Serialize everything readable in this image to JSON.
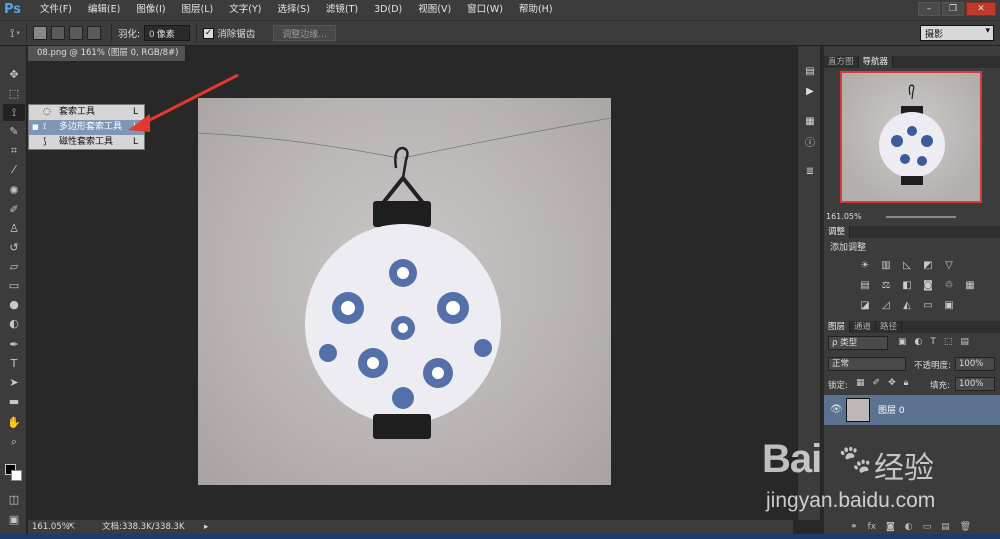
{
  "app": {
    "logo": "Ps"
  },
  "menubar": {
    "items": [
      "文件(F)",
      "编辑(E)",
      "图像(I)",
      "图层(L)",
      "文字(Y)",
      "选择(S)",
      "滤镜(T)",
      "3D(D)",
      "视图(V)",
      "窗口(W)",
      "帮助(H)"
    ]
  },
  "options": {
    "feather_label": "羽化:",
    "feather_value": "0 像素",
    "antialias_label": "消除锯齿",
    "refine_label": "调整边缘...",
    "workspace": "摄影"
  },
  "document": {
    "tab_label": "08.png @ 161% (图层 0, RGB/8#)",
    "zoom": "161.05%",
    "doc_info": "文档:338.3K/338.3K"
  },
  "flyout": {
    "items": [
      {
        "label": "套索工具",
        "shortcut": "L",
        "icon": "lasso-icon",
        "selected": false
      },
      {
        "label": "多边形套索工具",
        "shortcut": "L",
        "icon": "polygonal-lasso-icon",
        "selected": true
      },
      {
        "label": "磁性套索工具",
        "shortcut": "L",
        "icon": "magnetic-lasso-icon",
        "selected": false
      }
    ]
  },
  "panels": {
    "nav_tabs": [
      "直方图",
      "导航器"
    ],
    "nav_zoom": "161.05%",
    "adjust_tabs": [
      "调整"
    ],
    "adjust_title": "添加调整",
    "layer_tabs": [
      "图层",
      "通道",
      "路径"
    ],
    "layer_filter": "ρ 类型",
    "blend_mode": "正常",
    "opacity_label": "不透明度:",
    "opacity_value": "100%",
    "lock_label": "锁定:",
    "fill_label": "填充:",
    "fill_value": "100%",
    "layer_name": "图层 0"
  },
  "watermark": {
    "brand": "Bai",
    "brand2": "经验",
    "url": "jingyan.baidu.com"
  },
  "colors": {
    "accent": "#5aa0e6",
    "selection": "#8096b5",
    "arrow": "#e0392f",
    "layer_selected": "#5b7291"
  }
}
